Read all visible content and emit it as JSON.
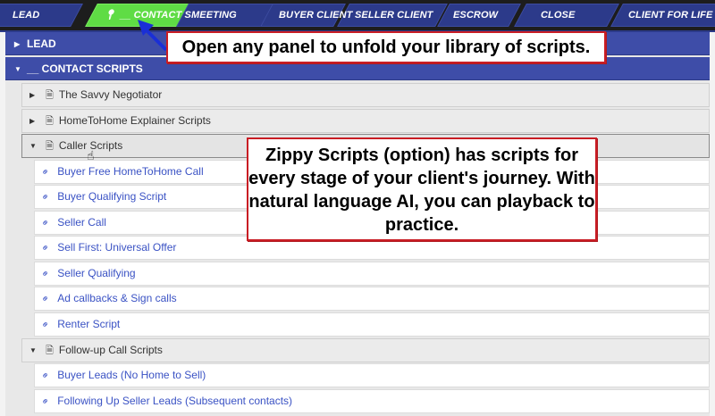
{
  "pipeline": {
    "stages": [
      {
        "label": "LEAD",
        "active": false
      },
      {
        "label": "__ CONTACT S",
        "active": true
      },
      {
        "label": "MEETING",
        "active": false
      },
      {
        "label": "BUYER CLIENT",
        "active": false
      },
      {
        "label": "SELLER CLIENT",
        "active": false
      },
      {
        "label": "ESCROW",
        "active": false
      },
      {
        "label": "CLOSE",
        "active": false
      },
      {
        "label": "CLIENT FOR LIFE",
        "active": false
      }
    ],
    "active_color": "#5fdc45",
    "stage_color": "#2c3a8a"
  },
  "library": {
    "panels": [
      {
        "label": "LEAD",
        "expanded": false
      },
      {
        "label": "__ CONTACT SCRIPTS",
        "expanded": true
      }
    ],
    "groups": [
      {
        "label": "The Savvy Negotiator",
        "expanded": false
      },
      {
        "label": "HomeToHome Explainer Scripts",
        "expanded": false
      },
      {
        "label": "Caller Scripts",
        "expanded": true
      },
      {
        "label": "Follow-up Call Scripts",
        "expanded": true
      }
    ],
    "caller_scripts": [
      "Buyer Free HomeToHome Call",
      "Buyer Qualifying Script",
      "Seller Call",
      "Sell First: Universal Offer",
      "Seller Qualifying",
      "Ad callbacks & Sign calls",
      "Renter Script"
    ],
    "followup_scripts": [
      "Buyer Leads (No Home to Sell)",
      "Following Up Seller Leads (Subsequent contacts)"
    ]
  },
  "callouts": {
    "top": "Open any panel to unfold your library of scripts.",
    "middle": "Zippy Scripts (option) has scripts for every stage of your client's journey. With natural language AI, you can playback to practice.",
    "border_color": "#c91d24"
  },
  "icons": {
    "pin": "map-pin-icon",
    "caret_right": "caret-right-icon",
    "caret_down": "caret-down-icon",
    "document": "document-icon",
    "link": "link-icon",
    "cursor": "hand-cursor-icon"
  }
}
